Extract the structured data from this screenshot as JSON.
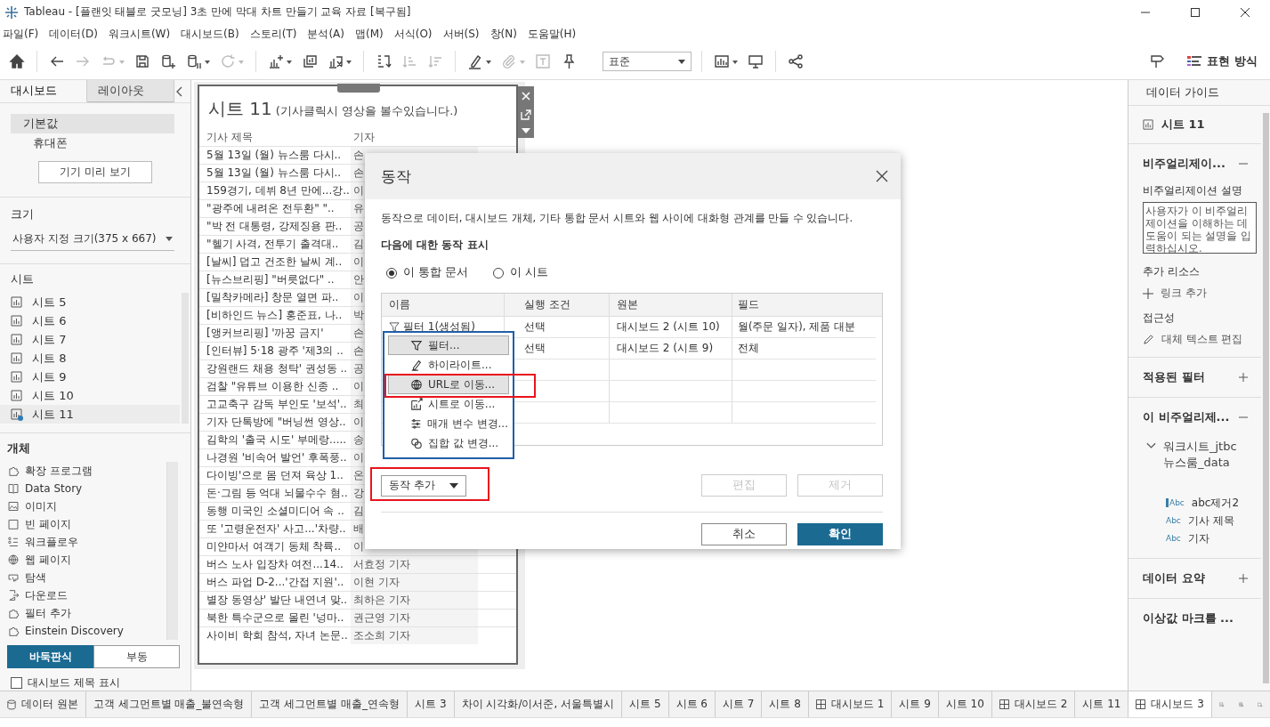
{
  "window": {
    "title": "Tableau - [플랜잇 태블로 굿모닝] 3초 만에 막대 차트 만들기 교육 자료 [복구됨]"
  },
  "menu": [
    "파일(F)",
    "데이터(D)",
    "워크시트(W)",
    "대시보드(B)",
    "스토리(T)",
    "분석(A)",
    "맵(M)",
    "서식(O)",
    "서버(S)",
    "창(N)",
    "도움말(H)"
  ],
  "toolbar": {
    "items": [
      {
        "kind": "home",
        "disabled": false,
        "dropdown": false
      },
      {
        "kind": "separator"
      },
      {
        "kind": "back",
        "disabled": false,
        "dropdown": false
      },
      {
        "kind": "forward",
        "disabled": true,
        "dropdown": false
      },
      {
        "kind": "redo",
        "disabled": true,
        "dropdown": true
      },
      {
        "kind": "save",
        "disabled": false,
        "dropdown": false
      },
      {
        "kind": "new-datasource",
        "disabled": false,
        "dropdown": false
      },
      {
        "kind": "pause-datasource",
        "disabled": false,
        "dropdown": true
      },
      {
        "kind": "refresh",
        "disabled": true,
        "dropdown": true
      },
      {
        "kind": "separator"
      },
      {
        "kind": "new-sheet",
        "disabled": false,
        "dropdown": true
      },
      {
        "kind": "duplicate",
        "disabled": false,
        "dropdown": false
      },
      {
        "kind": "clear",
        "disabled": false,
        "dropdown": true
      },
      {
        "kind": "separator"
      },
      {
        "kind": "swap",
        "disabled": false,
        "dropdown": false
      },
      {
        "kind": "sort-asc",
        "disabled": true,
        "dropdown": false
      },
      {
        "kind": "sort-desc",
        "disabled": true,
        "dropdown": false
      },
      {
        "kind": "separator"
      },
      {
        "kind": "highlight",
        "disabled": false,
        "dropdown": true
      },
      {
        "kind": "attach",
        "disabled": true,
        "dropdown": true
      },
      {
        "kind": "label",
        "disabled": true,
        "dropdown": false
      },
      {
        "kind": "pin",
        "disabled": false,
        "dropdown": false
      }
    ],
    "fit": {
      "value": "표준"
    },
    "after_fit": [
      {
        "kind": "chart",
        "disabled": false,
        "dropdown": true
      },
      {
        "kind": "present",
        "disabled": false,
        "dropdown": false
      },
      {
        "kind": "separator"
      },
      {
        "kind": "share",
        "disabled": false,
        "dropdown": false
      }
    ],
    "show_me": {
      "label": "표현 방식"
    }
  },
  "left_panel": {
    "tabs": [
      {
        "label": "대시보드",
        "selected": true
      },
      {
        "label": "레이아웃",
        "selected": false
      }
    ],
    "devices": [
      {
        "label": "기본값",
        "selected": true
      },
      {
        "label": "휴대폰",
        "selected": false
      }
    ],
    "preview_button": "기기 미리 보기",
    "size": {
      "title": "크기",
      "value": "사용자 지정 크기(375 x 667)"
    },
    "sheets": {
      "title": "시트",
      "items": [
        {
          "label": "시트 5",
          "used": false
        },
        {
          "label": "시트 6",
          "used": false
        },
        {
          "label": "시트 7",
          "used": false
        },
        {
          "label": "시트 8",
          "used": false
        },
        {
          "label": "시트 9",
          "used": false
        },
        {
          "label": "시트 10",
          "used": false
        },
        {
          "label": "시트 11",
          "used": true
        }
      ]
    },
    "objects": {
      "title": "개체",
      "items": [
        {
          "label": "확장 프로그램",
          "kind": "extension"
        },
        {
          "label": "Data Story",
          "kind": "story"
        },
        {
          "label": "이미지",
          "kind": "image"
        },
        {
          "label": "빈 페이지",
          "kind": "blank"
        },
        {
          "label": "워크플로우",
          "kind": "workflow"
        },
        {
          "label": "웹 페이지",
          "kind": "web"
        },
        {
          "label": "탐색",
          "kind": "navigation"
        },
        {
          "label": "다운로드",
          "kind": "download"
        },
        {
          "label": "필터 추가",
          "kind": "extension"
        },
        {
          "label": "Einstein Discovery",
          "kind": "extension"
        }
      ]
    },
    "layout_mode": [
      {
        "label": "바둑판식",
        "selected": true
      },
      {
        "label": "부동",
        "selected": false
      }
    ],
    "show_title": {
      "label": "대시보드 제목 표시",
      "checked": false
    }
  },
  "sheet": {
    "title": "시트 11",
    "subtitle": "(기사클릭시 영상을 볼수있습니다.)",
    "columns": [
      "기사 제목",
      "기자"
    ],
    "rows": [
      [
        "5월 13일 (월) 뉴스룸 다시..",
        "손"
      ],
      [
        "5월 13일 (월) 뉴스룸 다시..",
        "손"
      ],
      [
        "159경기, 데뷔 8년 만에...강..",
        "이"
      ],
      [
        "\"광주에 내려온 전두환\" \"..",
        "유"
      ],
      [
        "\"박 전 대통령, 강제징용 판..",
        "공"
      ],
      [
        "\"헬기 사격, 전투기 출격대..",
        "김"
      ],
      [
        "[날씨] 덥고 건조한 날씨 계..",
        "이"
      ],
      [
        "[뉴스브리핑] \"버릇없다\" ..",
        "안"
      ],
      [
        "[밀착카메라] 창문 열면 파..",
        "이"
      ],
      [
        "[비하인드 뉴스] 홍준표, 나..",
        "박"
      ],
      [
        "[앵커브리핑] '까꿍 금지'",
        "손"
      ],
      [
        "[인터뷰] 5·18 광주 '제3의 ..",
        "손"
      ],
      [
        "강원랜드 채용 청탁' 권성동 ..",
        "공"
      ],
      [
        "검찰 \"유튜브 이용한 신종 ..",
        "이"
      ],
      [
        "고교축구 감독 부인도 '보석'..",
        "최"
      ],
      [
        "기자 단톡방에 \"버닝썬 영상..",
        "이"
      ],
      [
        "김학의 '출국 시도' 부메랑.....",
        "송"
      ],
      [
        "나경원 '비속어 발언' 후폭풍..",
        "이"
      ],
      [
        "다이빙'으로 몸 던져 육상 1..",
        "온"
      ],
      [
        "돈·그림 등 억대 뇌물수수 혐..",
        "강"
      ],
      [
        "동행 미국인 소셜미디어 속 ..",
        "김"
      ],
      [
        "또 '고령운전자' 사고...'차량..",
        "배"
      ],
      [
        "미얀마서 여객기 동체 착륙..",
        "이"
      ],
      [
        "버스 노사 입장차 여전...14..",
        "서효정 기자"
      ],
      [
        "버스 파업 D-2...'간접 지원'..",
        "이현 기자"
      ],
      [
        "별장 동영상' 발단 내연녀 맞..",
        "최하은 기자"
      ],
      [
        "북한 특수군으로 몰린 '넝마..",
        "권근영 기자"
      ],
      [
        "사이비 학회 참석, 자녀 논문..",
        "조소희 기자"
      ]
    ]
  },
  "dialog": {
    "title": "동작",
    "description": "동작으로 데이터, 대시보드 개체, 기타 통합 문서 시트와 웹 사이에 대화형 관계를 만들 수 있습니다.",
    "scope_label": "다음에 대한 동작 표시",
    "scope": [
      {
        "label": "이 통합 문서",
        "selected": true
      },
      {
        "label": "이 시트",
        "selected": false
      }
    ],
    "columns": [
      "이름",
      "실행 조건",
      "원본",
      "필드"
    ],
    "rows": [
      {
        "name": "필터 1(생성됨)",
        "run_on": "선택",
        "source": "대시보드 2 (시트 10)",
        "fields": "월(주문 일자), 제품 대분"
      },
      {
        "run_on": "선택",
        "source": "대시보드 2 (시트 9)",
        "fields": "전체"
      }
    ],
    "add_menu": [
      {
        "label": "필터...",
        "kind": "filter",
        "highlighted": true,
        "annotated": false
      },
      {
        "label": "하이라이트...",
        "kind": "highlight",
        "highlighted": false,
        "annotated": false
      },
      {
        "label": "URL로 이동...",
        "kind": "url",
        "highlighted": true,
        "annotated": true
      },
      {
        "label": "시트로 이동...",
        "kind": "sheet",
        "highlighted": false,
        "annotated": false
      },
      {
        "label": "매개 변수 변경...",
        "kind": "parameter",
        "highlighted": false,
        "annotated": false
      },
      {
        "label": "집합 값 변경...",
        "kind": "set",
        "highlighted": false,
        "annotated": false
      }
    ],
    "add_button": {
      "label": "동작 추가",
      "annotated": true
    },
    "edit_button": {
      "label": "편집",
      "disabled": true
    },
    "remove_button": {
      "label": "제거",
      "disabled": true
    },
    "cancel_button": "취소",
    "ok_button": "확인"
  },
  "data_guide": {
    "title": "데이터 가이드",
    "sheet": "시트 11",
    "viz_section": {
      "title": "비주얼리제이...",
      "expanded": true
    },
    "description_label": "비주얼리제이션 설명",
    "description_placeholder": "사용자가 이 비주얼리제이션을 이해하는 데 도움이 되는 설명을 입력하십시오.",
    "resources_label": "추가 리소스",
    "add_link": "링크 추가",
    "accessibility_label": "접근성",
    "alt_text": "대체 텍스트 편집",
    "filters_section": {
      "title": "적용된 필터",
      "expanded": false
    },
    "data_section": {
      "title": "이 비주얼리제...",
      "expanded": true
    },
    "datasource": {
      "name": "워크시트_jtbc 뉴스룸_data",
      "expanded": true,
      "fields": [
        {
          "label": "abc제거2",
          "type_label": "Abc",
          "kind": "calculated"
        },
        {
          "label": "기사 제목",
          "type_label": "Abc",
          "kind": "field"
        },
        {
          "label": "기자",
          "type_label": "Abc",
          "kind": "field"
        }
      ]
    },
    "summary_section": {
      "title": "데이터 요약",
      "expanded": false
    },
    "outlier_section": {
      "title": "이상값 마크를 ..."
    }
  },
  "tabs": [
    {
      "label": "데이터 원본",
      "kind": "datasource",
      "selected": false
    },
    {
      "label": "고객 세그먼트별 매출_불연속형",
      "kind": "sheet",
      "selected": false
    },
    {
      "label": "고객 세그먼트별 매출_연속형",
      "kind": "sheet",
      "selected": false
    },
    {
      "label": "시트 3",
      "kind": "sheet",
      "selected": false
    },
    {
      "label": "차이 시각화/이서준, 서울특별시",
      "kind": "sheet",
      "selected": false
    },
    {
      "label": "시트 5",
      "kind": "sheet",
      "selected": false
    },
    {
      "label": "시트 6",
      "kind": "sheet",
      "selected": false
    },
    {
      "label": "시트 7",
      "kind": "sheet",
      "selected": false
    },
    {
      "label": "시트 8",
      "kind": "sheet",
      "selected": false
    },
    {
      "label": "대시보드 1",
      "kind": "dashboard",
      "selected": false
    },
    {
      "label": "시트 9",
      "kind": "sheet",
      "selected": false
    },
    {
      "label": "시트 10",
      "kind": "sheet",
      "selected": false
    },
    {
      "label": "대시보드 2",
      "kind": "dashboard",
      "selected": false
    },
    {
      "label": "시트 11",
      "kind": "sheet",
      "selected": false
    },
    {
      "label": "대시보드 3",
      "kind": "dashboard",
      "selected": true
    }
  ]
}
